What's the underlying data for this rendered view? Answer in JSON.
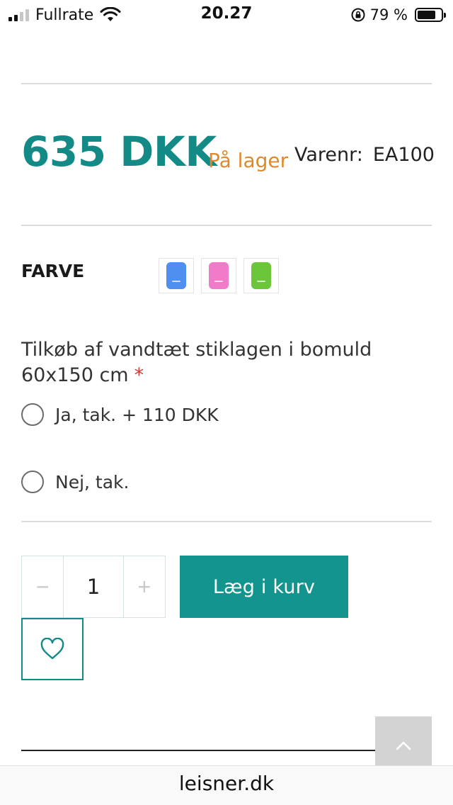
{
  "status_bar": {
    "carrier": "Fullrate",
    "time": "20.27",
    "battery_percent": "79 %",
    "battery_level": 0.79,
    "signal_bars_active": 2,
    "icons": [
      "signal-icon",
      "wifi-icon",
      "rotation-lock-icon",
      "battery-icon"
    ]
  },
  "product": {
    "price": "635 DKK",
    "stock_status": "På lager",
    "sku_label": "Varenr:",
    "sku_value": "EA100"
  },
  "color": {
    "label": "FARVE",
    "swatches": [
      {
        "name": "blue",
        "hex": "#4f8ff0"
      },
      {
        "name": "pink",
        "hex": "#f07bc8"
      },
      {
        "name": "green",
        "hex": "#6cc63a"
      }
    ]
  },
  "addon": {
    "question": "Tilkøb af vandtæt stiklagen i bomuld 60x150 cm",
    "required_mark": "*",
    "options": [
      {
        "label": "Ja, tak. + 110 DKK",
        "selected": false
      },
      {
        "label": "Nej, tak.",
        "selected": false
      }
    ]
  },
  "cart": {
    "minus": "−",
    "quantity": "1",
    "plus": "+",
    "add_to_cart": "Læg i kurv"
  },
  "colors": {
    "accent": "#138a86",
    "button": "#13948f",
    "stock": "#dd8a2e",
    "required": "#d23a2f"
  },
  "browser": {
    "url": "leisner.dk"
  }
}
